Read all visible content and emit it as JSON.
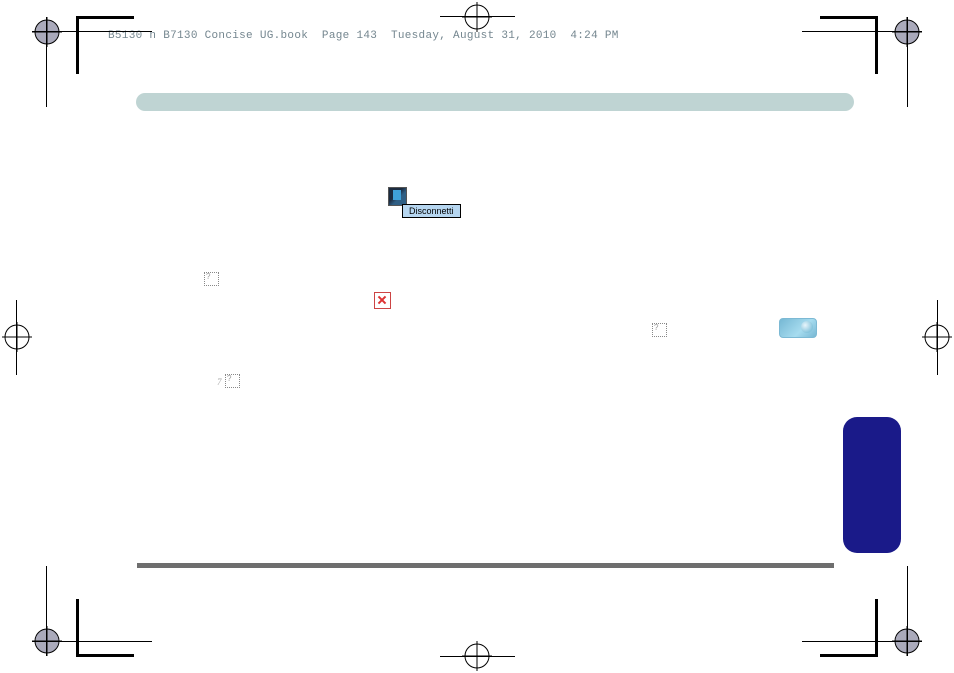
{
  "header_line": "B5130 n B7130 Concise UG.book  Page 143  Tuesday, August 31, 2010  4:24 PM",
  "tooltip_label": "Disconnetti"
}
